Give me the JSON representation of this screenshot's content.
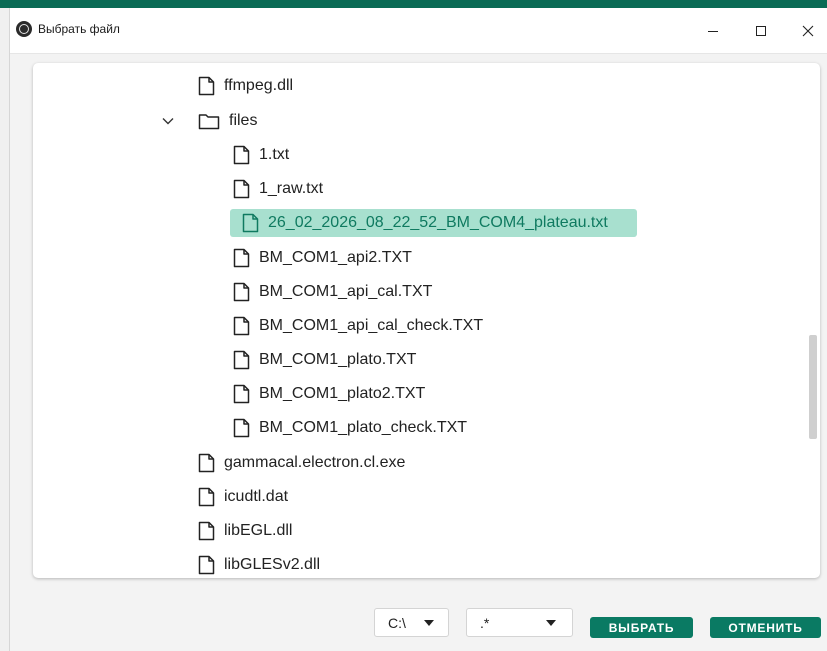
{
  "window": {
    "title": "Выбрать файл",
    "accent": "#0a6b55"
  },
  "tree": {
    "items": [
      {
        "name": "ffmpeg.dll",
        "type": "file",
        "depth": 1
      },
      {
        "name": "files",
        "type": "folder",
        "depth": 1,
        "expanded": true
      },
      {
        "name": "1.txt",
        "type": "file",
        "depth": 2
      },
      {
        "name": "1_raw.txt",
        "type": "file",
        "depth": 2
      },
      {
        "name": "26_02_2026_08_22_52_BM_COM4_plateau.txt",
        "type": "file",
        "depth": 2,
        "selected": true
      },
      {
        "name": "BM_COM1_api2.TXT",
        "type": "file",
        "depth": 2
      },
      {
        "name": "BM_COM1_api_cal.TXT",
        "type": "file",
        "depth": 2
      },
      {
        "name": "BM_COM1_api_cal_check.TXT",
        "type": "file",
        "depth": 2
      },
      {
        "name": "BM_COM1_plato.TXT",
        "type": "file",
        "depth": 2
      },
      {
        "name": "BM_COM1_plato2.TXT",
        "type": "file",
        "depth": 2
      },
      {
        "name": "BM_COM1_plato_check.TXT",
        "type": "file",
        "depth": 2
      },
      {
        "name": "gammacal.electron.cl.exe",
        "type": "file",
        "depth": 1
      },
      {
        "name": "icudtl.dat",
        "type": "file",
        "depth": 1
      },
      {
        "name": "libEGL.dll",
        "type": "file",
        "depth": 1
      },
      {
        "name": "libGLESv2.dll",
        "type": "file",
        "depth": 1
      }
    ],
    "selected_color": "#a8e0cf",
    "selected_text_color": "#0f7a60"
  },
  "footer": {
    "drive_select": {
      "value": "C:\\"
    },
    "filter_select": {
      "value": ".*"
    },
    "select_button": "ВЫБРАТЬ",
    "cancel_button": "ОТМЕНИТЬ",
    "button_color": "#0a7a63"
  }
}
